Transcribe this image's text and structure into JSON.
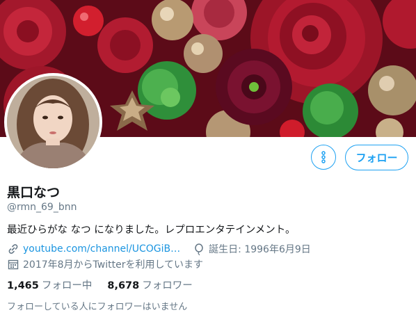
{
  "profile": {
    "display_name": "黒口なつ",
    "handle": "@rmn_69_bnn",
    "bio": "最近ひらがな なつ になりました。レプロエンタテインメント。",
    "website": "youtube.com/channel/UCOGiB…",
    "birthday": "誕生日: 1996年6月9日",
    "joined": "2017年8月からTwitterを利用しています"
  },
  "actions": {
    "follow_label": "フォロー",
    "more_icon": "more-vertical-icon"
  },
  "stats": {
    "following_count": "1,465",
    "following_label": "フォロー中",
    "followers_count": "8,678",
    "followers_label": "フォロワー"
  },
  "known_followers": "フォローしている人にフォロワーはいません",
  "colors": {
    "accent": "#1da1f2",
    "link": "#1b95e0",
    "secondary_text": "#657786"
  }
}
